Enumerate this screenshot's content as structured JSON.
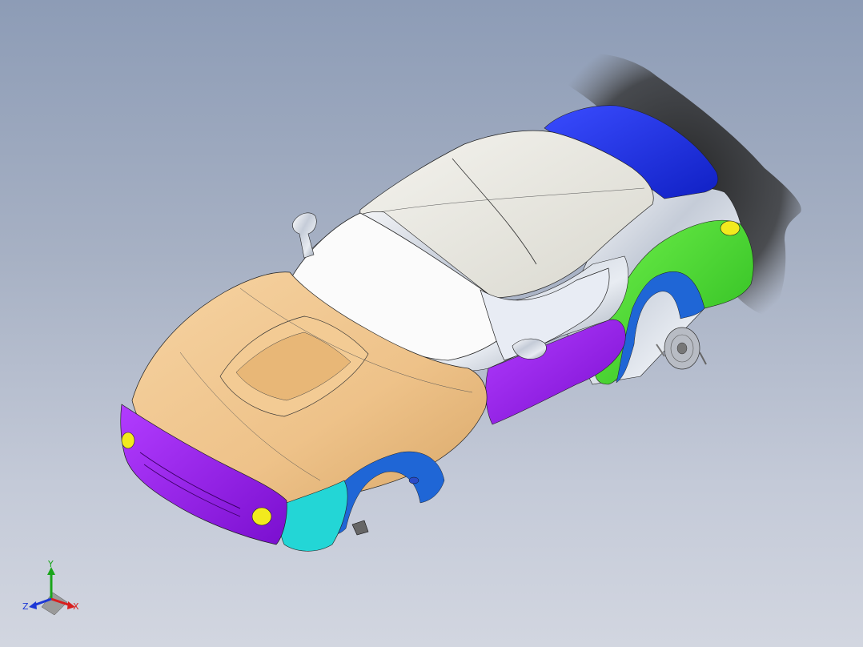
{
  "app": {
    "view": "CAD 3D viewport"
  },
  "triad": {
    "x_label": "X",
    "y_label": "Y",
    "z_label": "Z",
    "x_color": "#d81e1e",
    "y_color": "#1aa51a",
    "z_color": "#1c38d6"
  },
  "colors": {
    "background_top": "#8d9cb6",
    "background_bottom": "#d2d6e0",
    "hood": "#f2c891",
    "front_fascia": "#9a12e8",
    "side_panel": "#7a17d6",
    "roof": "#ecebe4",
    "windshield": "#fbfbfb",
    "rear_deck": "#1a2de6",
    "rear_fender": "#3fdc2e",
    "wheel_arch": "#1f66d6",
    "lower_trim": "#23d6d6",
    "headlight": "#f2ea1e",
    "shadow": "#262626"
  },
  "model": {
    "name": "car-body-surface-model"
  }
}
